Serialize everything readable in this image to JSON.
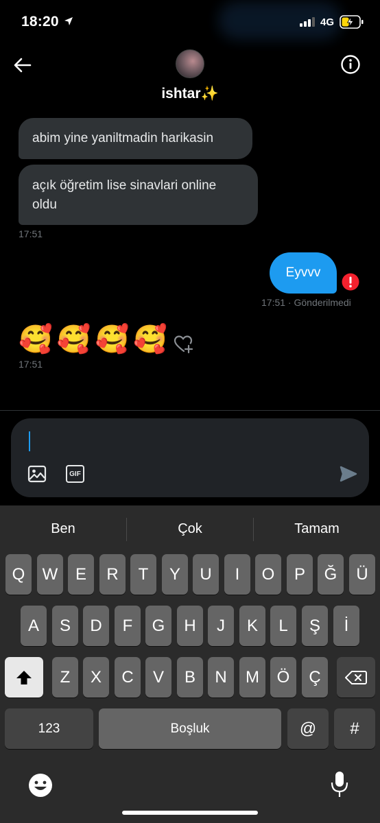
{
  "status_bar": {
    "time": "18:20",
    "network": "4G",
    "icons": [
      "location-arrow-icon",
      "signal-icon",
      "battery-charging-icon"
    ]
  },
  "header": {
    "contact_name": "ishtar✨",
    "icons": [
      "back-arrow-icon",
      "info-icon",
      "avatar"
    ]
  },
  "messages": {
    "incoming_1": "abim yine yaniltmadin harikasin",
    "incoming_2_line1": "açık öğretim lise sinavlari online",
    "incoming_2_line2": "oldu",
    "incoming_time": "17:51",
    "outgoing_text": "Eyvvv",
    "outgoing_status": "17:51 · Gönderilmedi",
    "emoji_text": "🥰🥰🥰🥰",
    "emoji_time": "17:51"
  },
  "composer": {
    "value": "",
    "icons": [
      "image-icon",
      "gif-icon",
      "send-icon"
    ],
    "gif_label": "GIF"
  },
  "keyboard": {
    "suggestions": [
      "Ben",
      "Çok",
      "Tamam"
    ],
    "row1": [
      "Q",
      "W",
      "E",
      "R",
      "T",
      "Y",
      "U",
      "I",
      "O",
      "P",
      "Ğ",
      "Ü"
    ],
    "row2": [
      "A",
      "S",
      "D",
      "F",
      "G",
      "H",
      "J",
      "K",
      "L",
      "Ş",
      "İ"
    ],
    "row3": [
      "Z",
      "X",
      "C",
      "V",
      "B",
      "N",
      "M",
      "Ö",
      "Ç"
    ],
    "numbers_key": "123",
    "space_key": "Boşluk",
    "at_key": "@",
    "hash_key": "#"
  },
  "colors": {
    "accent": "#1d9bf0",
    "bubble_in": "#2f3336",
    "error": "#f4212e",
    "keyboard_bg": "#2b2b2b"
  }
}
